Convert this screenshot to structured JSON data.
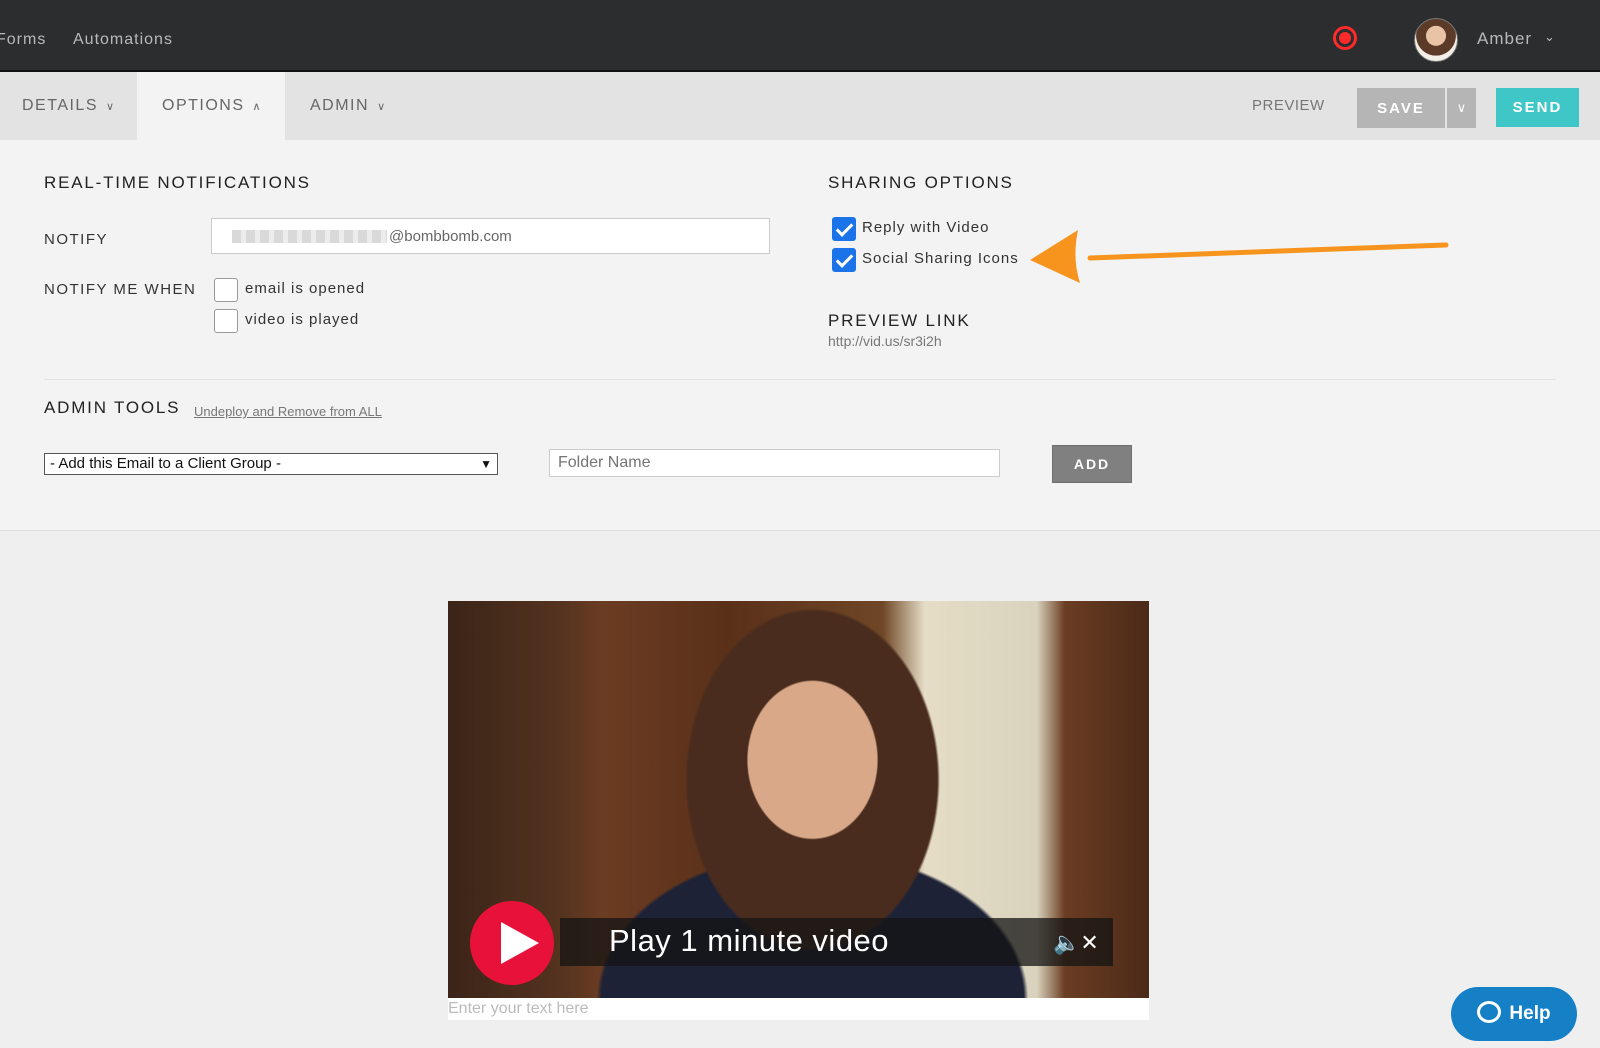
{
  "topnav": {
    "items": [
      "Forms",
      "Automations"
    ],
    "user_name": "Amber",
    "user_chevron": "⌄"
  },
  "subnav": {
    "tabs": [
      {
        "label": "DETAILS",
        "active": false
      },
      {
        "label": "OPTIONS",
        "active": true
      },
      {
        "label": "ADMIN",
        "active": false
      }
    ],
    "preview_label": "PREVIEW",
    "save_label": "SAVE",
    "send_label": "SEND"
  },
  "notifications": {
    "heading": "REAL-TIME NOTIFICATIONS",
    "notify_label": "NOTIFY",
    "notify_value": "@bombbomb.com",
    "notify_me_when_label": "NOTIFY ME WHEN",
    "options": [
      {
        "label": "email is opened",
        "checked": false
      },
      {
        "label": "video is played",
        "checked": false
      }
    ]
  },
  "sharing": {
    "heading": "SHARING OPTIONS",
    "options": [
      {
        "label": "Reply with Video",
        "checked": true
      },
      {
        "label": "Social Sharing Icons",
        "checked": true
      }
    ],
    "preview_link_label": "PREVIEW LINK",
    "preview_link_value": "http://vid.us/sr3i2h"
  },
  "admin": {
    "heading": "ADMIN TOOLS",
    "undeploy_label": "Undeploy and Remove from ALL",
    "group_select_value": "- Add this Email to a Client Group -",
    "folder_placeholder": "Folder Name",
    "add_label": "ADD"
  },
  "video": {
    "play_text": "Play 1 minute video",
    "caption_placeholder": "Enter your text here"
  },
  "help": {
    "label": "Help"
  },
  "colors": {
    "send": "#3fc6c7",
    "checkbox": "#1a73e8",
    "record": "#ff2a2a",
    "arrow": "#f7941d",
    "play": "#e8113a",
    "help": "#1580c6"
  }
}
